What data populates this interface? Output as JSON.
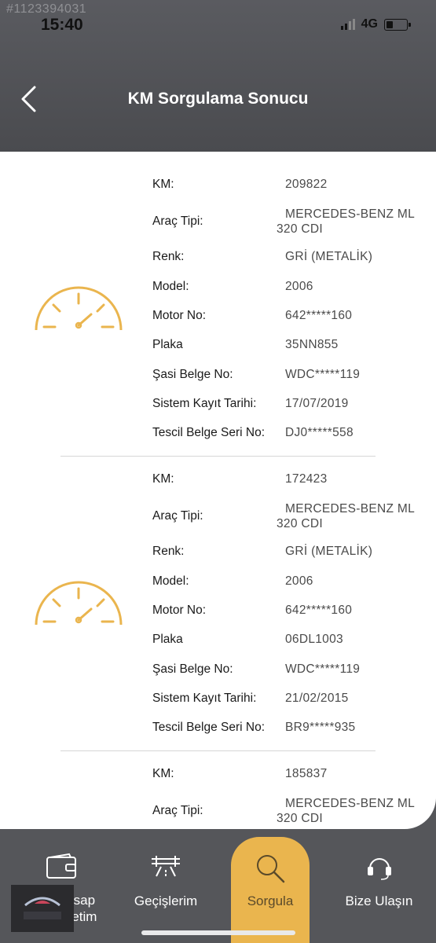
{
  "status_bar": {
    "watermark": "#1123394031",
    "time": "15:40",
    "network": "4G"
  },
  "header": {
    "title": "KM Sorgulama Sonucu"
  },
  "records": [
    {
      "fields": [
        {
          "label": "KM:",
          "value": "209822"
        },
        {
          "label": "Araç Tipi:",
          "value_line1": "MERCEDES-BENZ ML",
          "value_line2": "320 CDI"
        },
        {
          "label": "Renk:",
          "value": "GRİ (METALİK)"
        },
        {
          "label": "Model:",
          "value": "2006"
        },
        {
          "label": "Motor No:",
          "value": "642*****160"
        },
        {
          "label": "Plaka",
          "value": "35NN855"
        },
        {
          "label": "Şasi Belge No:",
          "value": "WDC*****119"
        },
        {
          "label": "Sistem Kayıt Tarihi:",
          "value": "17/07/2019"
        },
        {
          "label": "Tescil Belge Seri No:",
          "value": "DJ0*****558"
        }
      ]
    },
    {
      "fields": [
        {
          "label": "KM:",
          "value": "172423"
        },
        {
          "label": "Araç Tipi:",
          "value_line1": "MERCEDES-BENZ ML",
          "value_line2": "320 CDI"
        },
        {
          "label": "Renk:",
          "value": "GRİ (METALİK)"
        },
        {
          "label": "Model:",
          "value": "2006"
        },
        {
          "label": "Motor No:",
          "value": "642*****160"
        },
        {
          "label": "Plaka",
          "value": "06DL1003"
        },
        {
          "label": "Şasi Belge No:",
          "value": "WDC*****119"
        },
        {
          "label": "Sistem Kayıt Tarihi:",
          "value": "21/02/2015"
        },
        {
          "label": "Tescil Belge Seri No:",
          "value": "BR9*****935"
        }
      ]
    },
    {
      "fields": [
        {
          "label": "KM:",
          "value": "185837"
        },
        {
          "label": "Araç Tipi:",
          "value_line1": "MERCEDES-BENZ ML",
          "value_line2": "320 CDI"
        }
      ]
    }
  ],
  "tabs": [
    {
      "label_line1": "Hesap",
      "label_line2": "Özetim",
      "icon": "wallet-icon"
    },
    {
      "label": "Geçişlerim",
      "icon": "highway-icon"
    },
    {
      "label": "Sorgula",
      "icon": "search-icon",
      "active": true
    },
    {
      "label": "Bize Ulaşın",
      "icon": "headset-icon"
    }
  ],
  "colors": {
    "accent": "#eab54e",
    "header_bg": "#55565a",
    "card_bg": "#ffffff"
  }
}
